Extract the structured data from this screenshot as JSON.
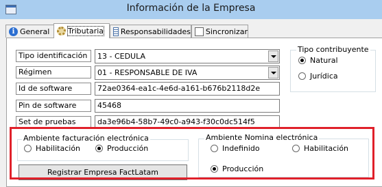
{
  "window": {
    "title": "Información de la Empresa"
  },
  "tabs": [
    {
      "label": "General",
      "icon": "info-icon"
    },
    {
      "label": "Tributaria",
      "icon": "gear-icon",
      "active": true
    },
    {
      "label": "Responsabilidades",
      "icon": "list-icon"
    },
    {
      "label": "Sincronizar",
      "icon": "doc-icon"
    }
  ],
  "fields": {
    "tipo_identificacion": {
      "label": "Tipo identificación",
      "value": "13 - CEDULA"
    },
    "regimen": {
      "label": "Régimen",
      "value": "01 - RESPONSABLE DE IVA"
    },
    "id_software": {
      "label": "Id de software",
      "value": "72ae0364-ea1c-4e6d-a161-b676b2118d2e"
    },
    "pin_software": {
      "label": "Pin de software",
      "value": "45468"
    },
    "set_pruebas": {
      "label": "Set de pruebas",
      "value": "da3e96b4-58b7-49c0-a943-f30c0dc514f5"
    }
  },
  "tipo_contribuyente": {
    "title": "Tipo contribuyente",
    "options": [
      "Natural",
      "Jurídica"
    ],
    "selected": "Natural"
  },
  "ambiente_facturacion": {
    "title": "Ambiente  facturación electrónica",
    "options": [
      "Habilitación",
      "Producción"
    ],
    "selected": "Producción"
  },
  "ambiente_nomina": {
    "title": "Ambiente  Nomina electrónica",
    "options": [
      "Indefinido",
      "Habilitación",
      "Producción"
    ],
    "selected": "Producción"
  },
  "register_button": {
    "label": "Registrar Empresa FactLatam"
  },
  "colors": {
    "titlebar": "#a9cdef",
    "highlight": "#e0202a",
    "panel": "#ffffff"
  }
}
